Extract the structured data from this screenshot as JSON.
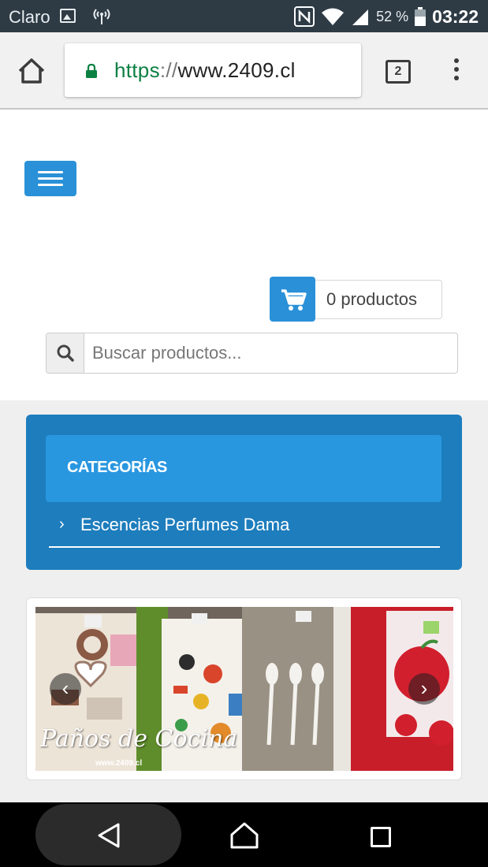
{
  "status_bar": {
    "carrier": "Claro",
    "battery_percent": "52 %",
    "time": "03:22",
    "icons": [
      "image-notification-icon",
      "antenna-icon",
      "nfc-icon",
      "wifi-icon",
      "signal-icon",
      "battery-icon"
    ]
  },
  "browser": {
    "url_scheme": "https",
    "url_separator": "://",
    "url_host": "www.2409.cl",
    "tab_count": "2"
  },
  "cart": {
    "label": "0 productos"
  },
  "search": {
    "placeholder": "Buscar productos..."
  },
  "categories": {
    "title": "CATEGORÍAS",
    "items": [
      {
        "label": "Escencias Perfumes Dama"
      }
    ]
  },
  "slider": {
    "caption": "Paños de Cocina",
    "watermark": "www.2409.cl",
    "prev_glyph": "‹",
    "next_glyph": "›"
  },
  "colors": {
    "accent_blue": "#2a91d8",
    "panel_blue": "#1d7dbd",
    "secure_green": "#0b8043",
    "statusbar": "#2e3b45"
  }
}
